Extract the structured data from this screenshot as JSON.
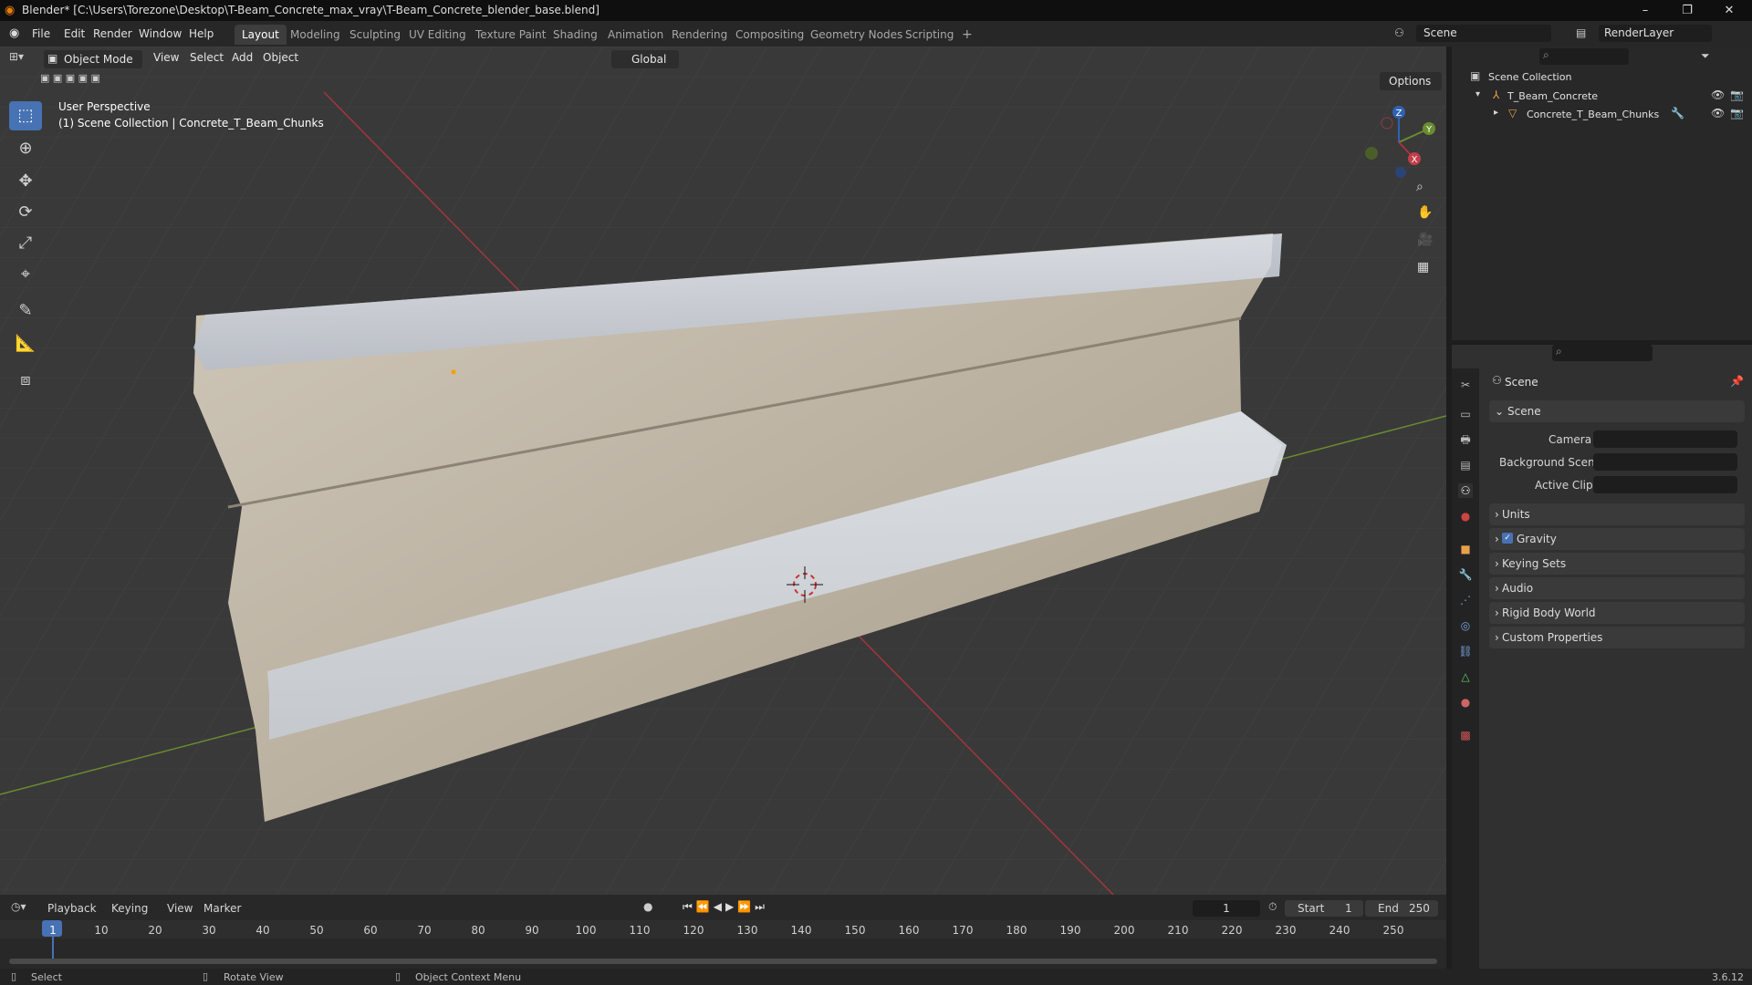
{
  "window": {
    "title": "Blender* [C:\\Users\\Torezone\\Desktop\\T-Beam_Concrete_max_vray\\T-Beam_Concrete_blender_base.blend]",
    "minimize": "–",
    "maximize": "❐",
    "close": "✕"
  },
  "menubar": {
    "file": "File",
    "edit": "Edit",
    "render": "Render",
    "window": "Window",
    "help": "Help"
  },
  "workspaces": [
    "Layout",
    "Modeling",
    "Sculpting",
    "UV Editing",
    "Texture Paint",
    "Shading",
    "Animation",
    "Rendering",
    "Compositing",
    "Geometry Nodes",
    "Scripting"
  ],
  "workspace_add": "+",
  "scene_selector": {
    "scene": "Scene",
    "render_layer": "RenderLayer"
  },
  "viewport_header": {
    "mode": "Object Mode",
    "view": "View",
    "select": "Select",
    "add": "Add",
    "object": "Object",
    "orientation": "Global",
    "options": "Options"
  },
  "viewport": {
    "perspective": "User Perspective",
    "collection_info": "(1) Scene Collection | Concrete_T_Beam_Chunks",
    "gizmo": {
      "z": "Z",
      "y": "Y",
      "x": "X"
    }
  },
  "outliner": {
    "root": "Scene Collection",
    "items": [
      {
        "label": "T_Beam_Concrete"
      },
      {
        "label": "Concrete_T_Beam_Chunks"
      }
    ]
  },
  "properties": {
    "context": "Scene",
    "section": "Scene",
    "fields": {
      "camera": "Camera",
      "background_scene": "Background Scene",
      "active_clip": "Active Clip"
    },
    "panels": [
      "Units",
      "Gravity",
      "Keying Sets",
      "Audio",
      "Rigid Body World",
      "Custom Properties"
    ],
    "gravity_checked": true
  },
  "timeline": {
    "playback": "Playback",
    "keying": "Keying",
    "view": "View",
    "marker": "Marker",
    "current_frame": "1",
    "start_label": "Start",
    "start": "1",
    "end_label": "End",
    "end": "250",
    "ticks": [
      "1",
      "10",
      "20",
      "30",
      "40",
      "50",
      "60",
      "70",
      "80",
      "90",
      "100",
      "110",
      "120",
      "130",
      "140",
      "150",
      "160",
      "170",
      "180",
      "190",
      "200",
      "210",
      "220",
      "230",
      "240",
      "250"
    ]
  },
  "statusbar": {
    "select": "Select",
    "rotate": "Rotate View",
    "context_menu": "Object Context Menu",
    "version": "3.6.12"
  },
  "colors": {
    "accent": "#4772b3",
    "x_axis": "#a4353d",
    "y_axis": "#6a8c2f",
    "z_axis": "#2f62b3"
  }
}
